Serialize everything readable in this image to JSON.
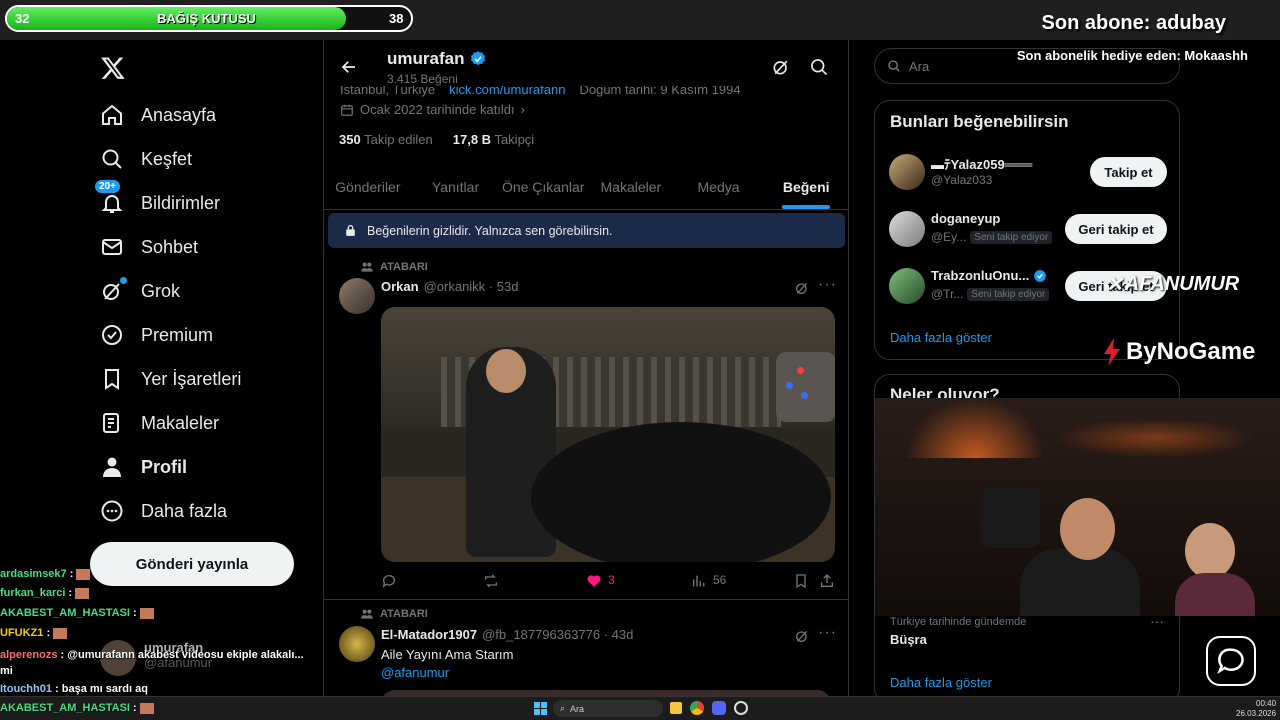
{
  "overlay": {
    "donation_left": "32",
    "donation_title": "BAĞIŞ KUTUSU",
    "donation_right": "38",
    "donation_progress": 0.84,
    "last_sub": "Son abone: adubay",
    "gift_sub": "Son abonelik hediye eden: Mokaashh",
    "watermark": "AFANUMUR",
    "sponsor": "ByNoGame"
  },
  "nav": {
    "items": [
      {
        "label": "Anasayfa",
        "icon": "home-icon"
      },
      {
        "label": "Keşfet",
        "icon": "search-icon"
      },
      {
        "label": "Bildirimler",
        "icon": "bell-icon",
        "badge": "20+"
      },
      {
        "label": "Sohbet",
        "icon": "mail-icon"
      },
      {
        "label": "Grok",
        "icon": "grok-icon"
      },
      {
        "label": "Premium",
        "icon": "verified-icon"
      },
      {
        "label": "Yer İşaretleri",
        "icon": "bookmark-icon"
      },
      {
        "label": "Makaleler",
        "icon": "articles-icon"
      },
      {
        "label": "Profil",
        "icon": "profile-icon"
      },
      {
        "label": "Daha fazla",
        "icon": "more-icon"
      }
    ],
    "post_button": "Gönderi yayınla"
  },
  "profile": {
    "name": "umurafan",
    "likes_count": "3.415 Beğeni",
    "location": "İstanbul, Türkiye",
    "link": "kick.com/umurafann",
    "birthday": "Doğum tarihi: 9 Kasım 1994",
    "joined": "Ocak 2022 tarihinde katıldı",
    "following_num": "350",
    "following_label": "Takip edilen",
    "followers_num": "17,8 B",
    "followers_label": "Takipçi"
  },
  "tabs": [
    "Gönderiler",
    "Yanıtlar",
    "Öne Çıkanlar",
    "Makaleler",
    "Medya",
    "Beğeni"
  ],
  "privacy_notice": "Beğenilerin gizlidir. Yalnızca sen görebilirsin.",
  "posts": [
    {
      "context": "ATABARI",
      "author": "Orkan",
      "handle": "@orkanikk · 53d",
      "replies": "",
      "reposts": "",
      "likes": "3",
      "views": "56"
    },
    {
      "context": "ATABARI",
      "author": "El-Matador1907",
      "handle": "@fb_187796363776 · 43d",
      "text": "Aile Yayını Ama Starım",
      "mention": "@afanumur"
    }
  ],
  "right": {
    "search_placeholder": "Ara",
    "suggest_title": "Bunları beğenebilirsin",
    "suggestions": [
      {
        "name": "▬ﾃYalaz059═══",
        "handle": "@Yalaz033",
        "button": "Takip et",
        "badge": ""
      },
      {
        "name": "doganeyup",
        "handle": "@Ey...",
        "button": "Geri takip et",
        "badge": "Seni takip ediyor"
      },
      {
        "name": "TrabzonluOnu...",
        "handle": "@Tr...",
        "button": "Geri takip et",
        "badge": "Seni takip ediyor"
      }
    ],
    "show_more": "Daha fazla göster",
    "trends_title": "Neler oluyor?",
    "trend_context": "Türkiye tarihinde gündemde",
    "trend_name": "Büşra",
    "trend_show_more": "Daha fazla göster"
  },
  "chat": [
    {
      "user": "ardasimsek7",
      "msg": "",
      "color": "#4ade80"
    },
    {
      "user": "furkan_karci",
      "msg": "",
      "color": "#4ade80"
    },
    {
      "user": "AKABEST_AM_HASTASI",
      "msg": "",
      "color": "#4ade80"
    },
    {
      "user": "UFUKZ1",
      "msg": "",
      "color": "#facc15"
    },
    {
      "user": "alperenozs",
      "msg": "@umurafann akabest videosu ekiple alakalı... mi",
      "color": "#f87171"
    },
    {
      "user": "Itouchh01",
      "msg": "başa mı sardı aq",
      "color": "#93c5fd"
    },
    {
      "user": "AKABEST_AM_HASTASI",
      "msg": "",
      "color": "#4ade80"
    }
  ],
  "account_switch": {
    "name": "umurafan",
    "handle": "@afanumur"
  },
  "taskbar": {
    "search": "Ara",
    "time": "00:40",
    "date": "26.03.2026"
  }
}
